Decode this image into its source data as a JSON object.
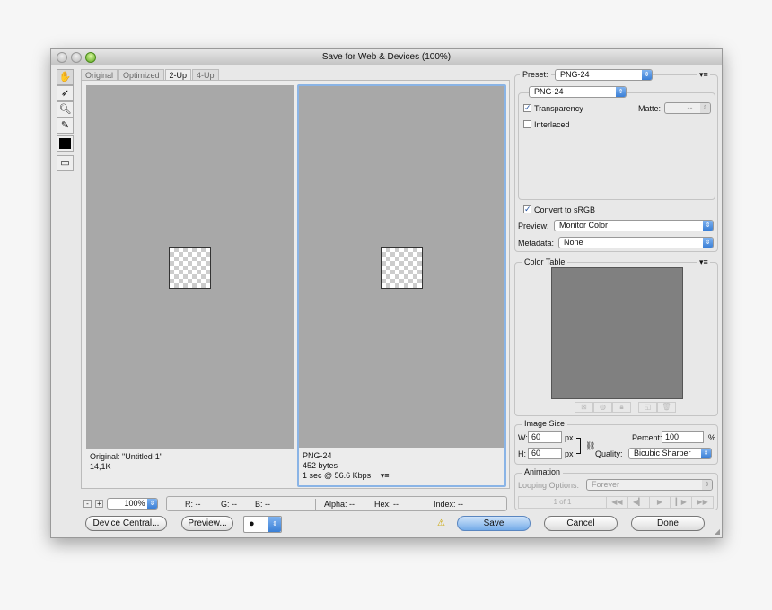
{
  "window": {
    "title": "Save for Web & Devices (100%)"
  },
  "tabs": [
    {
      "label": "Original"
    },
    {
      "label": "Optimized"
    },
    {
      "label": "2-Up"
    },
    {
      "label": "4-Up"
    }
  ],
  "active_tab": "2-Up",
  "panes": {
    "original": {
      "line1": "Original: \"Untitled-1\"",
      "line2": "14,1K"
    },
    "optimized": {
      "line1": "PNG-24",
      "line2": "452 bytes",
      "line3": "1 sec @ 56.6 Kbps"
    }
  },
  "statusbar": {
    "zoom": "100%",
    "r": "R: --",
    "g": "G: --",
    "b": "B: --",
    "alpha": "Alpha: --",
    "hex": "Hex: --",
    "index": "Index: --"
  },
  "buttons": {
    "device_central": "Device Central...",
    "preview": "Preview...",
    "save": "Save",
    "cancel": "Cancel",
    "done": "Done"
  },
  "settings": {
    "preset_label": "Preset:",
    "preset_value": "PNG-24",
    "format_value": "PNG-24",
    "transparency_label": "Transparency",
    "transparency_checked": true,
    "interlaced_label": "Interlaced",
    "interlaced_checked": false,
    "matte_label": "Matte:",
    "matte_value": "--",
    "convert_label": "Convert to sRGB",
    "convert_checked": true,
    "preview_label": "Preview:",
    "preview_value": "Monitor Color",
    "metadata_label": "Metadata:",
    "metadata_value": "None"
  },
  "color_table": {
    "title": "Color Table"
  },
  "image_size": {
    "title": "Image Size",
    "w_label": "W:",
    "w_value": "60",
    "h_label": "H:",
    "h_value": "60",
    "unit": "px",
    "percent_label": "Percent:",
    "percent_value": "100",
    "percent_unit": "%",
    "quality_label": "Quality:",
    "quality_value": "Bicubic Sharper"
  },
  "animation": {
    "title": "Animation",
    "looping_label": "Looping Options:",
    "looping_value": "Forever",
    "frame": "1 of 1"
  },
  "menu_glyph": "▾≡"
}
